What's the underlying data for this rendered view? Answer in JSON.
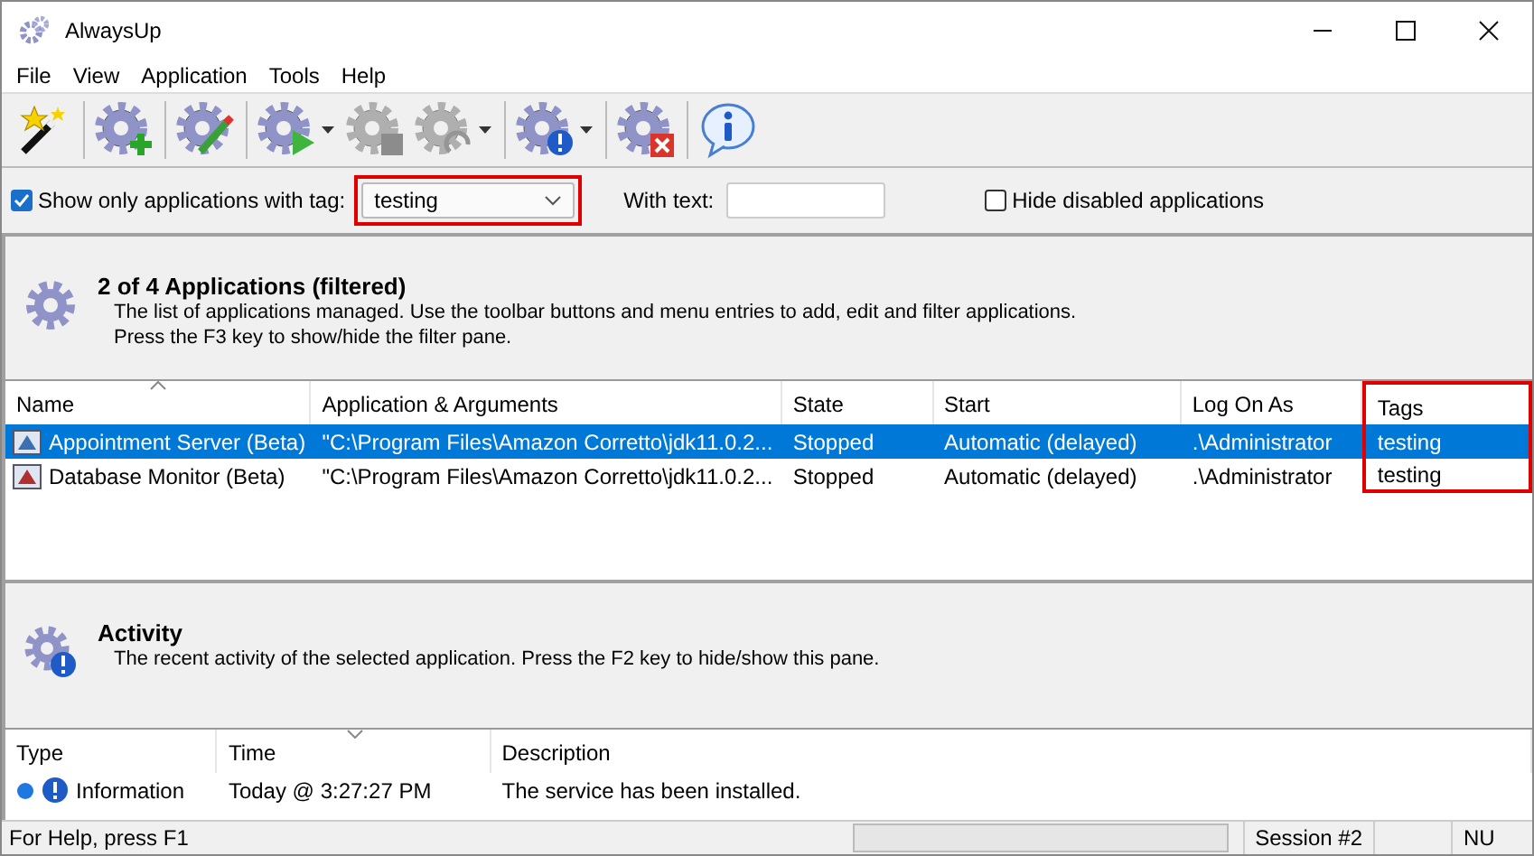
{
  "window": {
    "title": "AlwaysUp"
  },
  "menu": [
    "File",
    "View",
    "Application",
    "Tools",
    "Help"
  ],
  "toolbar": {
    "groups": [
      [
        {
          "kind": "wand",
          "disabled": false,
          "dropdown": false
        }
      ],
      [
        {
          "kind": "add",
          "disabled": false,
          "dropdown": false
        }
      ],
      [
        {
          "kind": "edit",
          "disabled": false,
          "dropdown": false
        }
      ],
      [
        {
          "kind": "start",
          "disabled": false,
          "dropdown": true
        },
        {
          "kind": "stop",
          "disabled": true,
          "dropdown": false
        },
        {
          "kind": "restart",
          "disabled": true,
          "dropdown": true
        }
      ],
      [
        {
          "kind": "alert",
          "disabled": false,
          "dropdown": true
        }
      ],
      [
        {
          "kind": "delete",
          "disabled": false,
          "dropdown": false
        }
      ],
      [
        {
          "kind": "info",
          "disabled": false,
          "dropdown": false
        }
      ]
    ]
  },
  "filter": {
    "tag_checkbox": {
      "label": "Show only applications with tag:",
      "checked": true
    },
    "tag_dropdown": {
      "value": "testing",
      "highlighted": true
    },
    "text_label": "With text:",
    "hide_disabled": {
      "label": "Hide disabled applications",
      "checked": false
    }
  },
  "applications_pane": {
    "title": "2 of 4 Applications (filtered)",
    "description": [
      "The list of applications managed. Use the toolbar buttons and menu entries to add, edit and filter applications.",
      "Press the F3 key to show/hide the filter pane."
    ]
  },
  "applications_table": {
    "columns": [
      {
        "label": "Name",
        "sorted": true,
        "highlighted": false
      },
      {
        "label": "Application & Arguments",
        "sorted": false,
        "highlighted": false
      },
      {
        "label": "State",
        "sorted": false,
        "highlighted": false
      },
      {
        "label": "Start",
        "sorted": false,
        "highlighted": false
      },
      {
        "label": "Log On As",
        "sorted": false,
        "highlighted": false
      },
      {
        "label": "Tags",
        "sorted": false,
        "highlighted": true
      }
    ],
    "rows": [
      {
        "selected": true,
        "cells": [
          "Appointment Server (Beta)",
          "\"C:\\Program Files\\Amazon Corretto\\jdk11.0.2...",
          "Stopped",
          "Automatic (delayed)",
          ".\\Administrator",
          "testing"
        ]
      },
      {
        "selected": false,
        "cells": [
          "Database Monitor (Beta)",
          "\"C:\\Program Files\\Amazon Corretto\\jdk11.0.2...",
          "Stopped",
          "Automatic (delayed)",
          ".\\Administrator",
          "testing"
        ]
      }
    ]
  },
  "activity_pane": {
    "title": "Activity",
    "description": "The recent activity of the selected application. Press the F2 key to hide/show this pane."
  },
  "activity_table": {
    "columns": [
      {
        "label": "Type",
        "sorted": false
      },
      {
        "label": "Time",
        "sorted": true
      },
      {
        "label": "Description",
        "sorted": false
      }
    ],
    "rows": [
      {
        "cells": [
          "Information",
          "Today @ 3:27:27 PM",
          "The service has been installed."
        ]
      }
    ]
  },
  "status_bar": {
    "help": "For Help, press F1",
    "progress": {
      "level": 0
    },
    "session": "Session #2",
    "indicator": "NU"
  }
}
